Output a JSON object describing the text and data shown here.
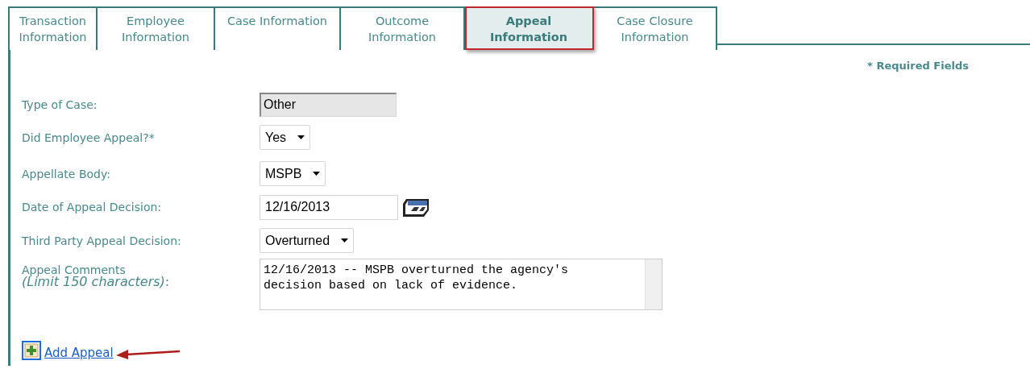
{
  "tabs": [
    {
      "label": "Transaction Information",
      "selected": false
    },
    {
      "label": "Employee Information",
      "selected": false
    },
    {
      "label": "Case Information",
      "selected": false
    },
    {
      "label": "Outcome Information",
      "selected": false
    },
    {
      "label": "Appeal Information",
      "selected": true
    },
    {
      "label": "Case Closure Information",
      "selected": false
    }
  ],
  "required_note": "* Required Fields",
  "fields": [
    {
      "kind": "readonly",
      "label": "Type of Case:",
      "value": "Other"
    },
    {
      "kind": "select",
      "label": "Did Employee Appeal?*",
      "value": "Yes"
    },
    {
      "kind": "select",
      "label": "Appellate Body:",
      "value": "MSPB"
    },
    {
      "kind": "date",
      "label": "Date of Appeal Decision:",
      "value": "12/16/2013"
    },
    {
      "kind": "select",
      "label": "Third Party Appeal Decision:",
      "value": "Overturned"
    },
    {
      "kind": "textarea",
      "label": "Appeal Comments",
      "sublabel": "*(Limit 150 characters)*:",
      "value": "12/16/2013 -- MSPB overturned the agency's\ndecision based on lack of evidence."
    }
  ],
  "add_link": "Add Appeal"
}
